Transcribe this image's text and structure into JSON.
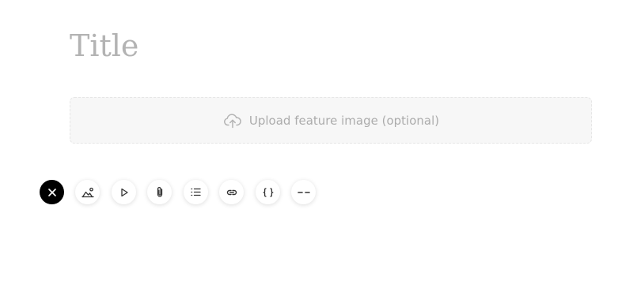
{
  "editor": {
    "title_placeholder": "Title",
    "title_value": ""
  },
  "upload": {
    "label": "Upload feature image (optional)",
    "icon": "cloud-upload-icon"
  },
  "toolbar": {
    "buttons": [
      {
        "icon": "close-icon",
        "label": "Close"
      },
      {
        "icon": "image-icon",
        "label": "Image"
      },
      {
        "icon": "play-icon",
        "label": "Video"
      },
      {
        "icon": "paperclip-icon",
        "label": "File"
      },
      {
        "icon": "list-icon",
        "label": "List"
      },
      {
        "icon": "link-icon",
        "label": "Link"
      },
      {
        "icon": "code-braces-icon",
        "label": "Code"
      },
      {
        "icon": "divider-icon",
        "label": "Divider"
      }
    ]
  },
  "colors": {
    "placeholder": "#b3b3b3",
    "upload_bg": "#f7f7f7",
    "upload_text": "#ababab",
    "close_button_bg": "#000000",
    "icon": "#333333"
  }
}
